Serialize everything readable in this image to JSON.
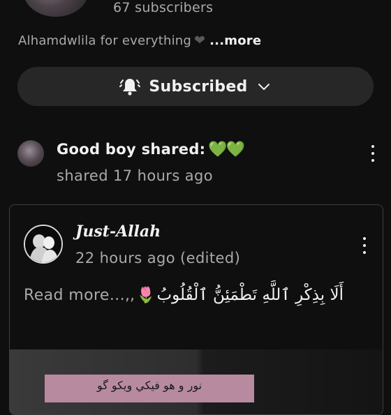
{
  "channel": {
    "subscribers": "67 subscribers",
    "description": "Alhamdwlila for everything",
    "description_more": "...more",
    "subscribe_label": "Subscribed"
  },
  "post": {
    "title": "Good boy shared:",
    "title_emoji": "💚💚",
    "meta": "shared 17 hours ago"
  },
  "shared_post": {
    "author": "Just-Allah",
    "meta": "22 hours ago (edited)",
    "read_more": "Read more...",
    "quote_mark": ",,",
    "arabic_text": "أَلَا بِذِكْرِ ٱللَّهِ تَطْمَئِنُّ ٱلْقُلُوبُ",
    "image_caption": "نور و هو فيكي ويكو گو"
  },
  "icons": {
    "bell": "bell-icon",
    "chevron": "chevron-down-icon",
    "heart": "black-heart-icon",
    "tulip": "tulip-icon",
    "kebab": "more-vert-icon"
  },
  "colors": {
    "background": "#0f0f0f",
    "button": "#272727",
    "secondary_text": "#aaaaaa",
    "emoji_green": "#3dbb3d"
  }
}
